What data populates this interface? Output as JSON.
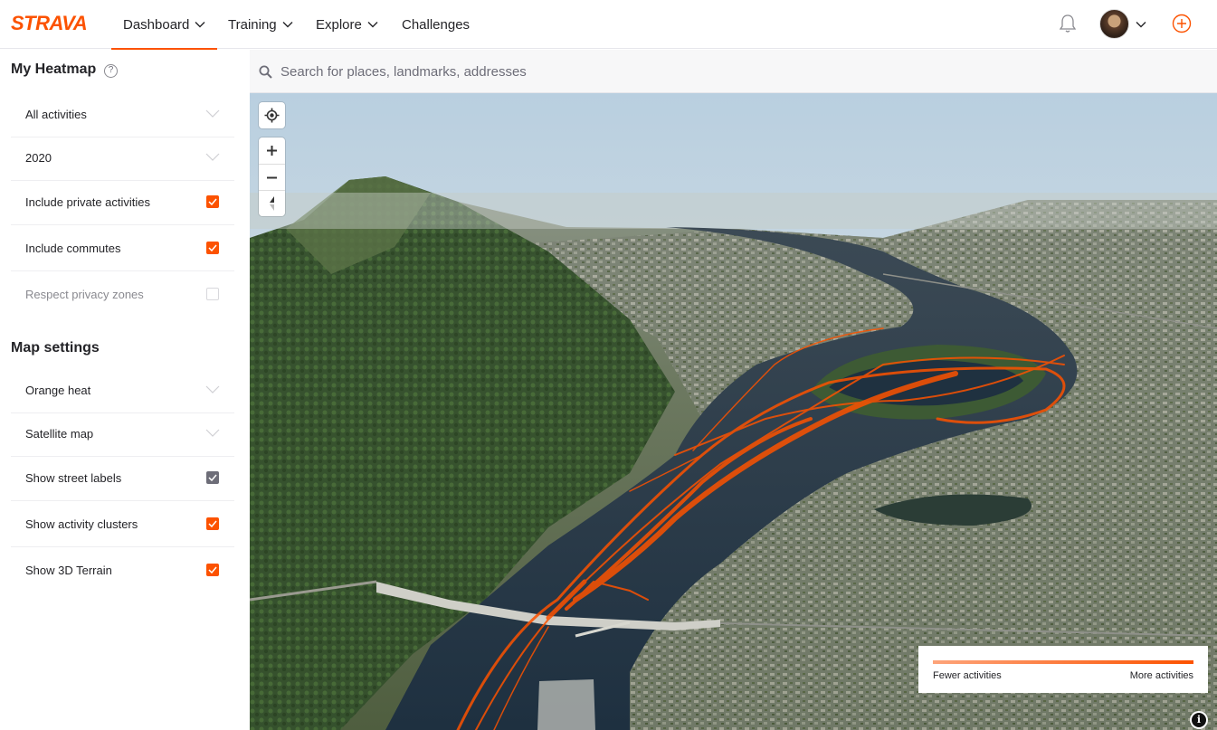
{
  "brand": {
    "logo_text": "STRAVA",
    "accent_color": "#fc5200"
  },
  "nav": {
    "items": [
      {
        "label": "Dashboard",
        "has_dropdown": true,
        "active": true
      },
      {
        "label": "Training",
        "has_dropdown": true,
        "active": false
      },
      {
        "label": "Explore",
        "has_dropdown": true,
        "active": false
      },
      {
        "label": "Challenges",
        "has_dropdown": false,
        "active": false
      }
    ],
    "icons": [
      "bell-icon",
      "avatar",
      "chevron-down-icon",
      "plus-circle-icon"
    ]
  },
  "sidebar": {
    "heatmap_title": "My Heatmap",
    "heatmap_help": "?",
    "heatmap_rows": [
      {
        "label": "All activities",
        "control": "dropdown"
      },
      {
        "label": "2020",
        "control": "dropdown"
      },
      {
        "label": "Include private activities",
        "control": "checkbox",
        "checked": true
      },
      {
        "label": "Include commutes",
        "control": "checkbox",
        "checked": true
      },
      {
        "label": "Respect privacy zones",
        "control": "checkbox",
        "checked": false,
        "disabled": true
      }
    ],
    "settings_title": "Map settings",
    "settings_rows": [
      {
        "label": "Orange heat",
        "control": "dropdown"
      },
      {
        "label": "Satellite map",
        "control": "dropdown"
      },
      {
        "label": "Show street labels",
        "control": "checkbox",
        "checked": true,
        "style": "grey"
      },
      {
        "label": "Show activity clusters",
        "control": "checkbox",
        "checked": true
      },
      {
        "label": "Show 3D Terrain",
        "control": "checkbox",
        "checked": true
      }
    ]
  },
  "map": {
    "search_placeholder": "Search for places, landmarks, addresses",
    "controls": [
      "locate-icon",
      "zoom-in-icon",
      "zoom-out-icon",
      "compass-icon"
    ],
    "legend": {
      "left": "Fewer activities",
      "right": "More activities"
    },
    "info_label": "i",
    "view": "3D satellite terrain, river with orange activity heat lines"
  }
}
